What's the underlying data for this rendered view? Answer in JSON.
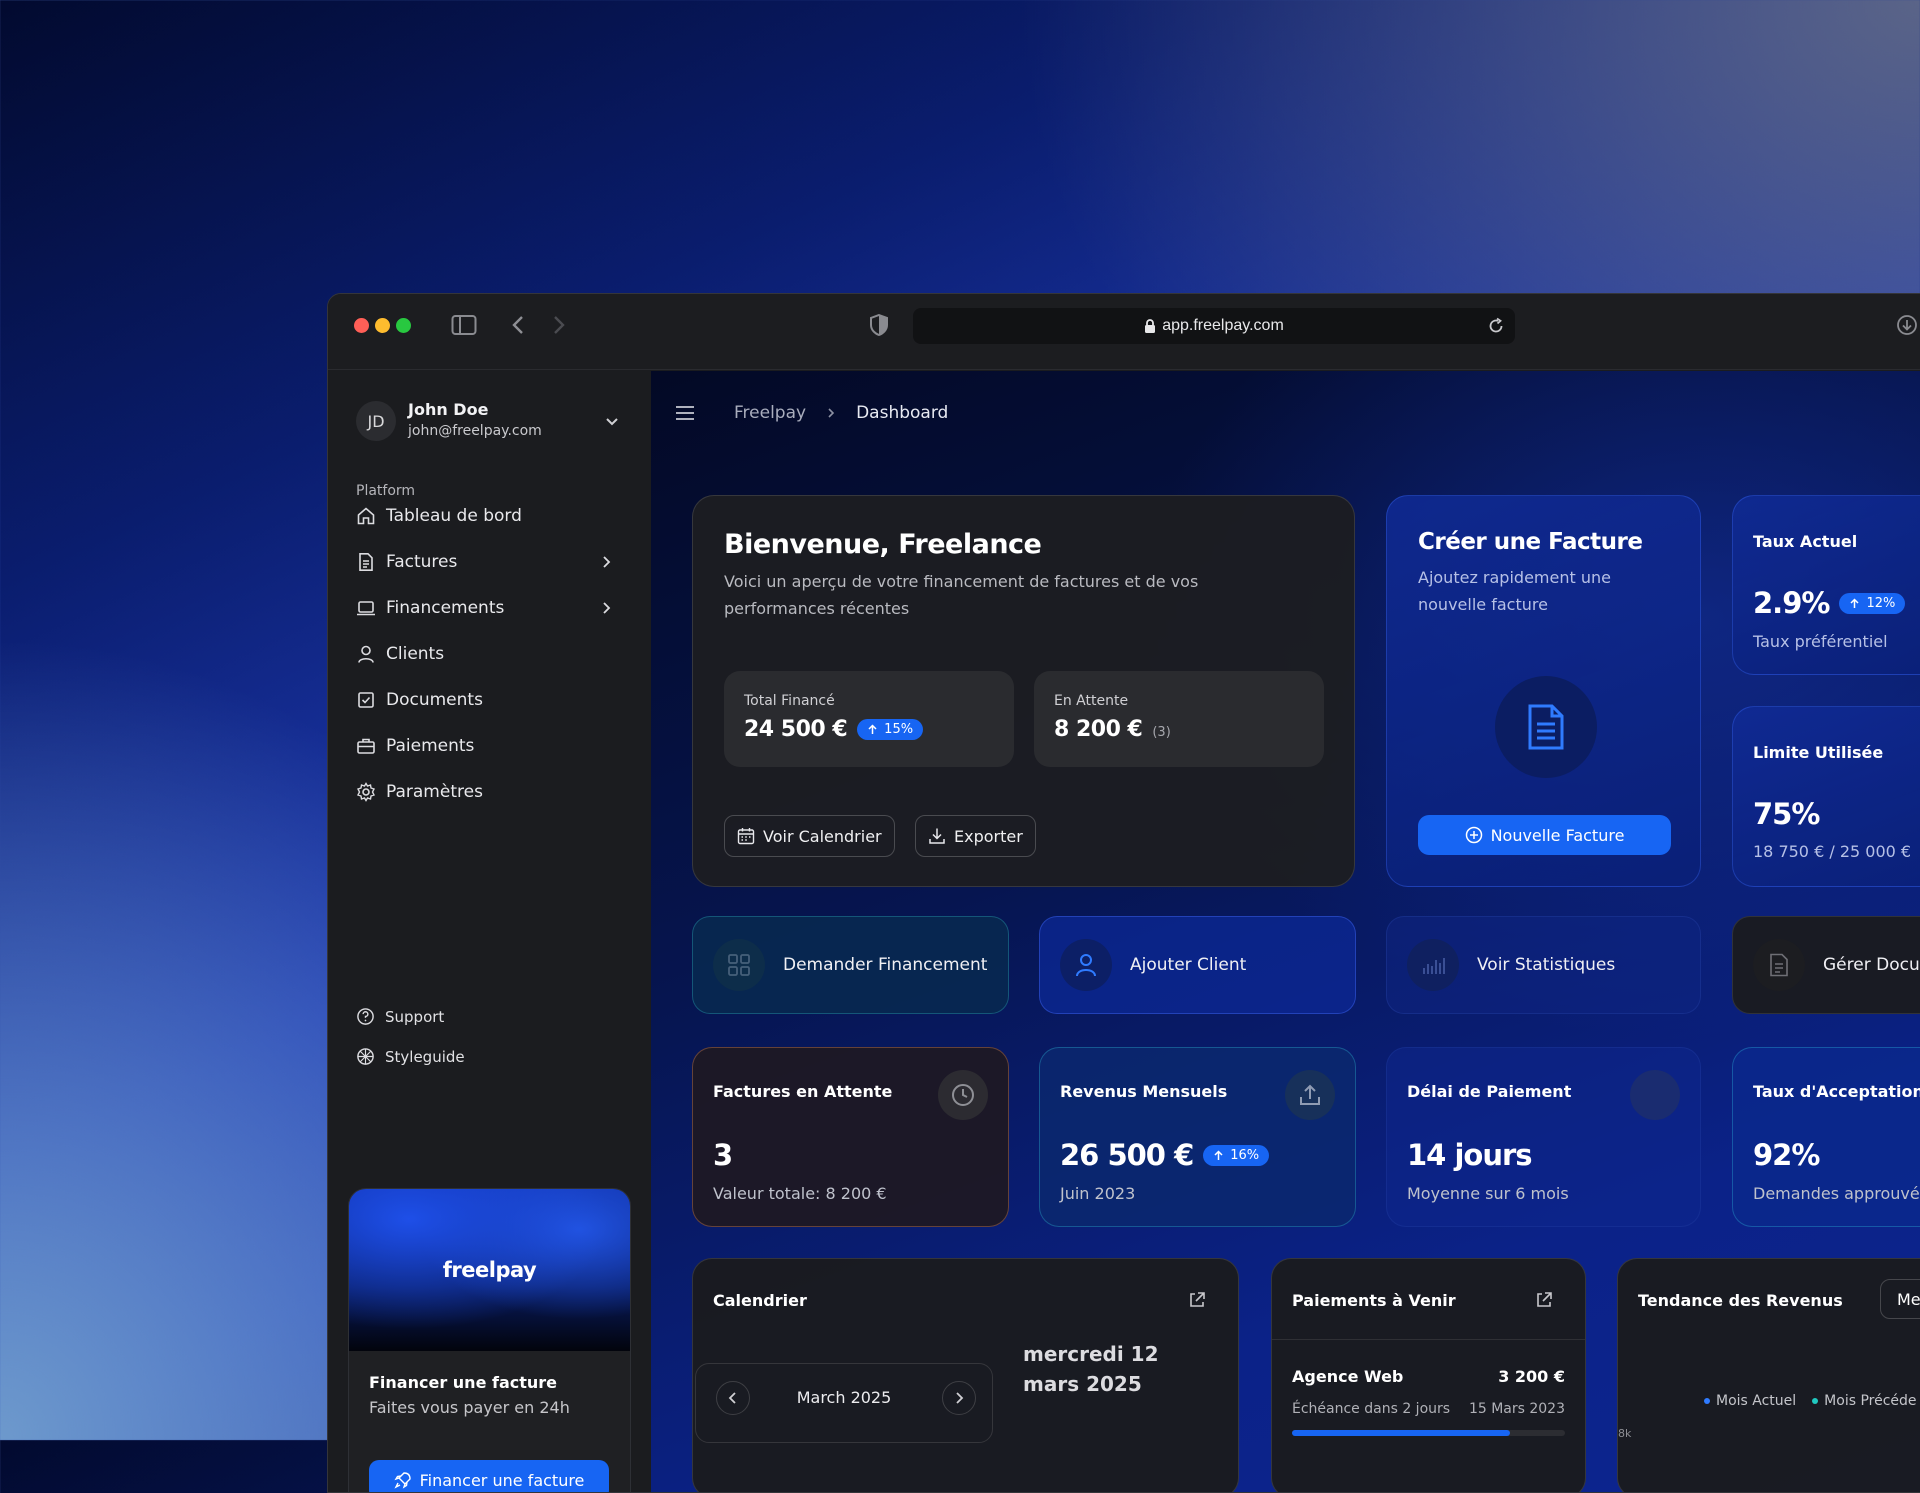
{
  "browser": {
    "url": "app.freelpay.com"
  },
  "user": {
    "initials": "JD",
    "name": "John Doe",
    "email": "john@freelpay.com"
  },
  "sidebar": {
    "section_label": "Platform",
    "items": [
      {
        "label": "Tableau de bord",
        "icon": "home-icon"
      },
      {
        "label": "Factures",
        "icon": "document-icon",
        "has_submenu": true
      },
      {
        "label": "Financements",
        "icon": "laptop-icon",
        "has_submenu": true
      },
      {
        "label": "Clients",
        "icon": "user-icon"
      },
      {
        "label": "Documents",
        "icon": "checkbox-icon"
      },
      {
        "label": "Paiements",
        "icon": "briefcase-icon"
      },
      {
        "label": "Paramètres",
        "icon": "gear-icon"
      }
    ],
    "footer_items": [
      {
        "label": "Support",
        "icon": "help-icon"
      },
      {
        "label": "Styleguide",
        "icon": "palette-icon"
      }
    ]
  },
  "promo": {
    "brand": "freelpay",
    "title": "Financer une facture",
    "subtitle": "Faites vous payer en 24h",
    "button": "Financer une facture"
  },
  "breadcrumb": {
    "root": "Freelpay",
    "current": "Dashboard"
  },
  "welcome": {
    "title": "Bienvenue, Freelance",
    "subtitle": "Voici un aperçu de votre financement de factures et de vos performances récentes",
    "total_label": "Total Financé",
    "total_value": "24 500 €",
    "total_badge": "15%",
    "pending_label": "En Attente",
    "pending_value": "8 200 €",
    "pending_count": "(3)",
    "calendar_button": "Voir Calendrier",
    "export_button": "Exporter"
  },
  "create_invoice": {
    "title": "Créer une Facture",
    "subtitle": "Ajoutez rapidement une nouvelle facture",
    "button": "Nouvelle Facture"
  },
  "rate": {
    "title": "Taux Actuel",
    "value": "2.9%",
    "badge": "12%",
    "subtitle": "Taux préférentiel"
  },
  "limit": {
    "title": "Limite Utilisée",
    "value": "75%",
    "subtitle": "18 750 € / 25 000 €"
  },
  "actions": [
    {
      "label": "Demander Financement",
      "icon": "grid-icon"
    },
    {
      "label": "Ajouter Client",
      "icon": "user-icon"
    },
    {
      "label": "Voir Statistiques",
      "icon": "chart-icon"
    },
    {
      "label": "Gérer Docu",
      "icon": "document-icon"
    }
  ],
  "metrics": [
    {
      "title": "Factures en Attente",
      "value": "3",
      "subtitle": "Valeur totale: 8 200 €",
      "icon": "clock-icon"
    },
    {
      "title": "Revenus Mensuels",
      "value": "26 500 €",
      "badge": "16%",
      "subtitle": "Juin 2023",
      "icon": "upload-icon"
    },
    {
      "title": "Délai de Paiement",
      "value": "14 jours",
      "subtitle": "Moyenne sur 6 mois",
      "icon": "circle-icon"
    },
    {
      "title": "Taux d'Acceptation",
      "value": "92%",
      "subtitle": "Demandes approuvé"
    }
  ],
  "calendar": {
    "title": "Calendrier",
    "month": "March 2025",
    "selected_date": "mercredi 12 mars 2025"
  },
  "upcoming": {
    "title": "Paiements à Venir",
    "client": "Agence Web",
    "amount": "3 200 €",
    "due": "Échéance dans 2 jours",
    "date": "15 Mars 2023",
    "progress": 0.8
  },
  "trend": {
    "title": "Tendance des Revenus",
    "select": "Me",
    "legend": [
      "Mois Actuel",
      "Mois Précéde"
    ],
    "axis_tick": "8k"
  },
  "colors": {
    "accent": "#1765f3",
    "panel": "#1b1c1f"
  }
}
